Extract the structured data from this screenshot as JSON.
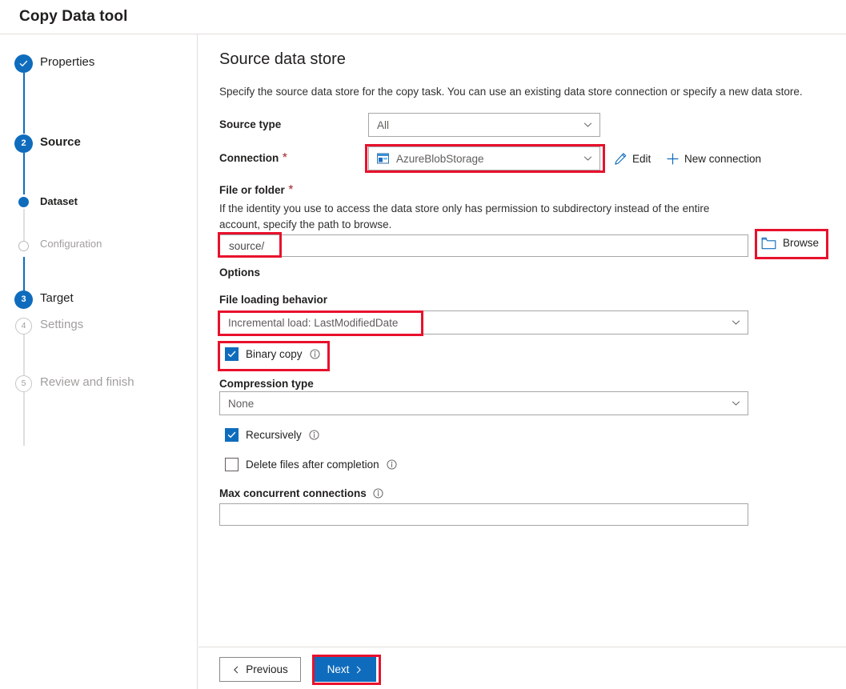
{
  "app": {
    "title": "Copy Data tool"
  },
  "sidebar": {
    "items": [
      {
        "label": "Properties",
        "marker": "check-icon",
        "state": "done"
      },
      {
        "label": "Source",
        "marker": "2",
        "state": "active"
      },
      {
        "label": "Dataset",
        "marker": "dot-icon",
        "state": "sub-active"
      },
      {
        "label": "Configuration",
        "marker": "hollow-dot-icon",
        "state": "sub-pending"
      },
      {
        "label": "Target",
        "marker": "3",
        "state": "active"
      },
      {
        "label": "Settings",
        "marker": "4",
        "state": "pending"
      },
      {
        "label": "Review and finish",
        "marker": "5",
        "state": "pending"
      }
    ]
  },
  "main": {
    "heading": "Source data store",
    "description": "Specify the source data store for the copy task. You can use an existing data store connection or specify a new data store.",
    "source_type": {
      "label": "Source type",
      "value": "All",
      "chevron": "chevron-down-icon"
    },
    "connection": {
      "label": "Connection",
      "required_mark": "*",
      "value": "AzureBlobStorage",
      "icon": "azure-blob-storage-icon",
      "chevron": "chevron-down-icon",
      "edit_label": "Edit",
      "edit_icon": "pencil-icon",
      "new_connection_label": "New connection",
      "new_connection_icon": "plus-icon"
    },
    "file_or_folder": {
      "label": "File or folder",
      "required_mark": "*",
      "help_line_1": "If the identity you use to access the data store only has permission to subdirectory instead of the entire",
      "help_line_2": "account, specify the path to browse.",
      "value": "source/",
      "browse_label": "Browse",
      "browse_icon": "folder-icon"
    },
    "options": {
      "heading": "Options",
      "file_loading_behavior": {
        "label": "File loading behavior",
        "value": "Incremental load: LastModifiedDate",
        "chevron": "chevron-down-icon"
      },
      "binary_copy": {
        "label": "Binary copy",
        "checked": true,
        "info_icon": "info-icon"
      },
      "compression_type": {
        "label": "Compression type",
        "value": "None",
        "chevron": "chevron-down-icon"
      },
      "recursively": {
        "label": "Recursively",
        "checked": true,
        "info_icon": "info-icon"
      },
      "delete_files": {
        "label": "Delete files after completion",
        "checked": false,
        "info_icon": "info-icon"
      },
      "max_concurrent_connections": {
        "label": "Max concurrent connections",
        "value": "",
        "info_icon": "info-icon"
      }
    }
  },
  "footer": {
    "previous_label": "Previous",
    "previous_icon": "chevron-left-icon",
    "next_label": "Next",
    "next_icon": "chevron-right-icon"
  },
  "colors": {
    "accent_blue": "#0f6cbd",
    "highlight_red": "#e8112d",
    "required_red": "#a4262c",
    "muted_text": "#a19f9d",
    "border": "#a6a6a6"
  }
}
